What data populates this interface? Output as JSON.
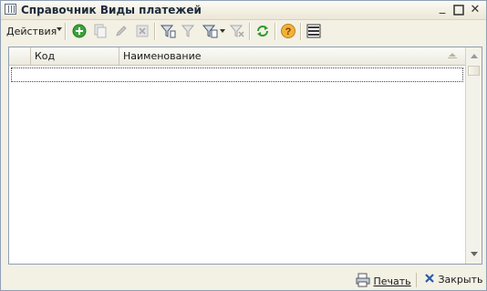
{
  "window": {
    "title": "Справочник Виды платежей",
    "minimize_label": "_",
    "close_label": "✕"
  },
  "toolbar": {
    "actions_label": "Действия",
    "buttons": [
      {
        "icon": "add-icon"
      },
      {
        "icon": "copy-icon"
      },
      {
        "icon": "edit-pencil-icon"
      },
      {
        "icon": "delete-icon"
      },
      {
        "icon": "filter-set-icon"
      },
      {
        "icon": "filter-by-value-icon"
      },
      {
        "icon": "filter-history-icon"
      },
      {
        "icon": "filter-clear-icon"
      },
      {
        "icon": "refresh-icon"
      },
      {
        "icon": "help-icon"
      },
      {
        "icon": "list-settings-icon"
      }
    ]
  },
  "table": {
    "columns": [
      "Код",
      "Наименование"
    ],
    "rows": []
  },
  "footer": {
    "print_label": "Печать",
    "close_label": "Закрыть"
  },
  "colors": {
    "accent_green": "#3aa33a",
    "window_bg": "#f3f0e4",
    "border": "#8f9fb4"
  }
}
